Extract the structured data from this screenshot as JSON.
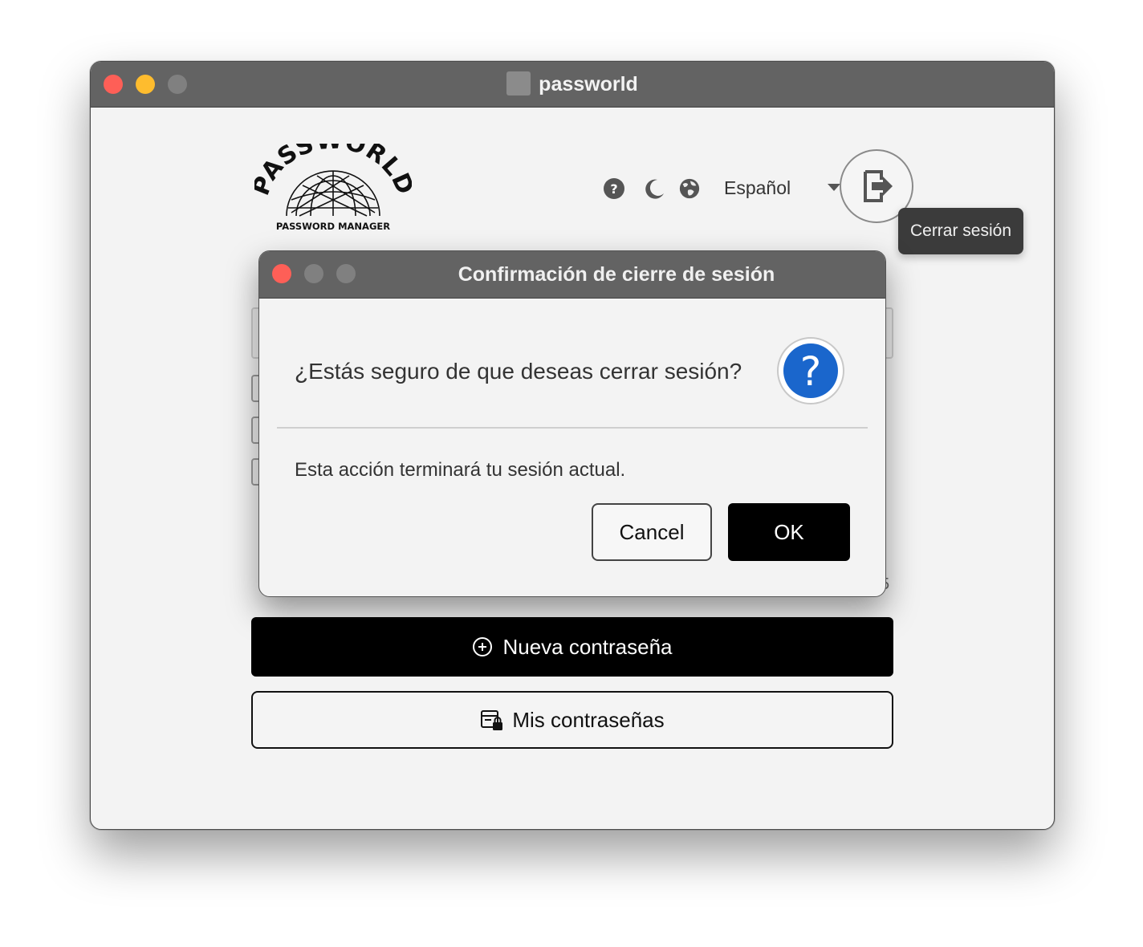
{
  "window": {
    "title": "passworld"
  },
  "logo": {
    "word": "PASSWORLD",
    "tagline": "PASSWORD MANAGER"
  },
  "toolbar": {
    "help_icon": "question-circle-icon",
    "theme_icon": "moon-icon",
    "language_icon": "globe-icon",
    "language_value": "Español",
    "logout_icon": "logout-arrow-icon",
    "logout_tooltip": "Cerrar sesión"
  },
  "main": {
    "new_password_label": "Nueva contraseña",
    "my_passwords_label": "Mis contraseñas",
    "partial_value": "5"
  },
  "dialog": {
    "title": "Confirmación de cierre de sesión",
    "question": "¿Estás seguro de que deseas cerrar sesión?",
    "detail": "Esta acción terminará tu sesión actual.",
    "cancel_label": "Cancel",
    "ok_label": "OK",
    "question_icon": "question-mark-icon"
  },
  "colors": {
    "titlebar": "#636363",
    "close": "#fe5f57",
    "minimize": "#febc2e",
    "inactive": "#808080",
    "primary_button": "#000000",
    "question_icon": "#1a66cc"
  }
}
